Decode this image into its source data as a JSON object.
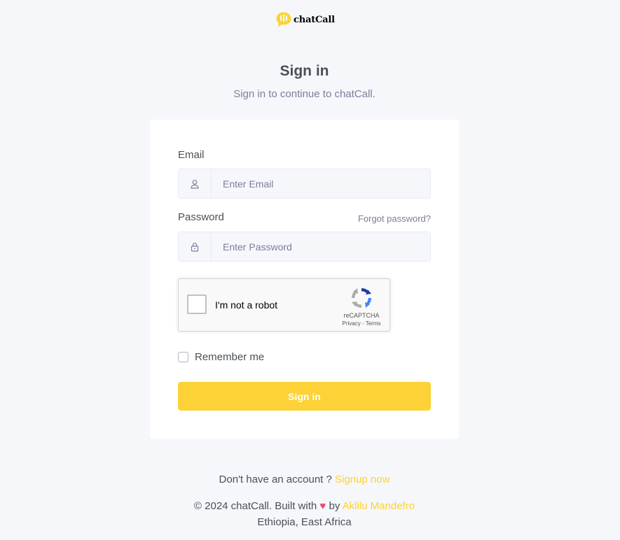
{
  "brand": {
    "name": "chatCall",
    "logo_icon": "chat-bubble-logo-icon",
    "accent_color": "#fcd237"
  },
  "heading": {
    "title": "Sign in",
    "subtitle": "Sign in to continue to chatCall."
  },
  "form": {
    "email": {
      "label": "Email",
      "placeholder": "Enter Email",
      "value": "",
      "icon": "user-icon"
    },
    "password": {
      "label": "Password",
      "placeholder": "Enter Password",
      "value": "",
      "icon": "lock-icon",
      "forgot_label": "Forgot password?"
    },
    "recaptcha": {
      "label": "I'm not a robot",
      "brand": "reCAPTCHA",
      "links": "Privacy - Terms",
      "checked": false
    },
    "remember": {
      "label": "Remember me",
      "checked": false
    },
    "submit_label": "Sign in"
  },
  "footer": {
    "signup_prompt": "Don't have an account ?",
    "signup_link": "Signup now",
    "copyright": "© 2024 chatCall. Built with",
    "heart": "♥",
    "by": "by",
    "author": "Aklilu Mandefro",
    "location": "Ethiopia, East Africa"
  }
}
